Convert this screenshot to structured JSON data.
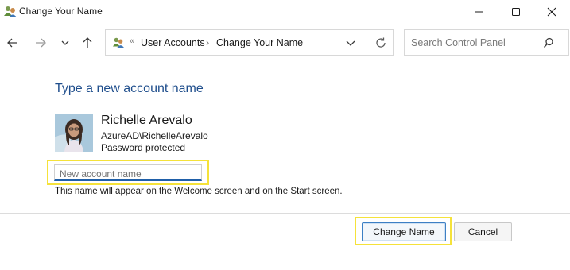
{
  "window": {
    "title": "Change Your Name",
    "controls": {
      "minimize": "minimize-icon",
      "maximize": "maximize-icon",
      "close": "close-icon"
    }
  },
  "nav": {
    "back": "arrow-left-icon",
    "forward": "arrow-right-icon",
    "recent": "chevron-down-icon",
    "up": "arrow-up-icon"
  },
  "address": {
    "prefix": "«",
    "crumbs": [
      "User Accounts",
      "Change Your Name"
    ],
    "separator": "›"
  },
  "search": {
    "placeholder": "Search Control Panel"
  },
  "main": {
    "heading": "Type a new account name",
    "user": {
      "name": "Richelle Arevalo",
      "account": "AzureAD\\RichelleArevalo",
      "status": "Password protected"
    },
    "input": {
      "placeholder": "New account name",
      "value": ""
    },
    "help_text": "This name will appear on the Welcome screen and on the Start screen."
  },
  "buttons": {
    "primary": "Change Name",
    "secondary": "Cancel"
  },
  "colors": {
    "heading": "#1f4e8c",
    "focus": "#1f5fa8",
    "highlight": "#f5e23a"
  }
}
